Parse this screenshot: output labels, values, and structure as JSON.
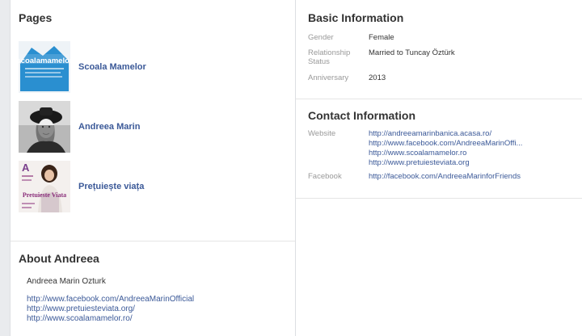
{
  "pages": {
    "title": "Pages",
    "items": [
      {
        "name": "Scoala Mamelor",
        "logo_text": "scoalamamelor"
      },
      {
        "name": "Andreea Marin"
      },
      {
        "name": "Prețuiește viața",
        "cover_text": "Pretuieste Viata",
        "cover_letter": "A"
      }
    ]
  },
  "about": {
    "title": "About Andreea",
    "name_line": "Andreea Marin Ozturk",
    "links": [
      "http://www.facebook.com/AndreeaMarinOfficial",
      "http://www.pretuiesteviata.org/",
      "http://www.scoalamamelor.ro/"
    ]
  },
  "basic": {
    "title": "Basic Information",
    "rows": [
      {
        "label": "Gender",
        "value": "Female"
      },
      {
        "label": "Relationship Status",
        "value": "Married to Tuncay Öztürk"
      },
      {
        "label": "Anniversary",
        "value": "2013"
      }
    ]
  },
  "contact": {
    "title": "Contact Information",
    "website_label": "Website",
    "websites": [
      "http://andreeamarinbanica.acasa.ro/",
      "http://www.facebook.com/AndreeaMarinOffi...",
      "http://www.scoalamamelor.ro",
      "http://www.pretuiesteviata.org"
    ],
    "facebook_label": "Facebook",
    "facebook": "http://facebook.com/AndreeaMarinforFriends"
  },
  "colors": {
    "link": "#3b5998",
    "label": "#999999",
    "logo_blue": "#2a8fd0"
  }
}
